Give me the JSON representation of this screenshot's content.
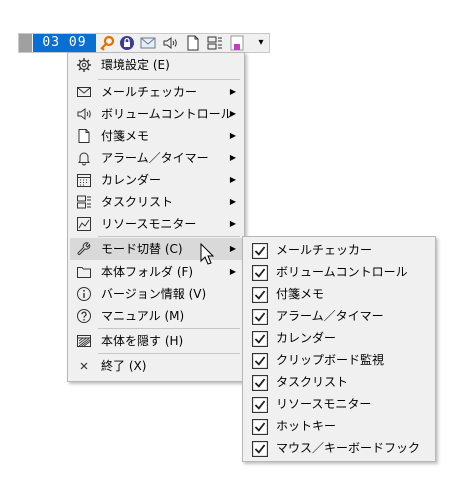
{
  "toolbar": {
    "clock": "03 09",
    "icons": [
      "key-icon",
      "lock-icon",
      "mail-icon",
      "speaker-icon",
      "memo-icon",
      "tasklist-icon",
      "color-swatch-icon"
    ],
    "dropdown": "▾"
  },
  "main_menu": {
    "items": [
      {
        "label": "環境設定 (E)",
        "icon": "gear-icon",
        "submenu": false
      },
      {
        "label": "メールチェッカー",
        "icon": "mail-icon",
        "submenu": true
      },
      {
        "label": "ボリュームコントロール",
        "icon": "speaker-icon",
        "submenu": true
      },
      {
        "label": "付箋メモ",
        "icon": "memo-icon",
        "submenu": true
      },
      {
        "label": "アラーム／タイマー",
        "icon": "bell-icon",
        "submenu": true
      },
      {
        "label": "カレンダー",
        "icon": "calendar-icon",
        "submenu": true
      },
      {
        "label": "タスクリスト",
        "icon": "tasklist-icon",
        "submenu": true
      },
      {
        "label": "リソースモニター",
        "icon": "chart-icon",
        "submenu": true
      },
      {
        "label": "モード切替 (C)",
        "icon": "wrench-icon",
        "submenu": true,
        "highlighted": true
      },
      {
        "label": "本体フォルダ (F)",
        "icon": "folder-icon",
        "submenu": true
      },
      {
        "label": "バージョン情報 (V)",
        "icon": "info-icon",
        "submenu": false
      },
      {
        "label": "マニュアル (M)",
        "icon": "help-icon",
        "submenu": false
      },
      {
        "label": "本体を隠す (H)",
        "icon": "hide-icon",
        "submenu": false
      },
      {
        "label": "終了 (X)",
        "icon": "close-icon",
        "submenu": false
      }
    ]
  },
  "sub_menu": {
    "items": [
      {
        "label": "メールチェッカー",
        "checked": true
      },
      {
        "label": "ボリュームコントロール",
        "checked": true
      },
      {
        "label": "付箋メモ",
        "checked": true
      },
      {
        "label": "アラーム／タイマー",
        "checked": true
      },
      {
        "label": "カレンダー",
        "checked": true
      },
      {
        "label": "クリップボード監視",
        "checked": true
      },
      {
        "label": "タスクリスト",
        "checked": true
      },
      {
        "label": "リソースモニター",
        "checked": true
      },
      {
        "label": "ホットキー",
        "checked": true
      },
      {
        "label": "マウス／キーボードフック",
        "checked": true
      }
    ]
  }
}
